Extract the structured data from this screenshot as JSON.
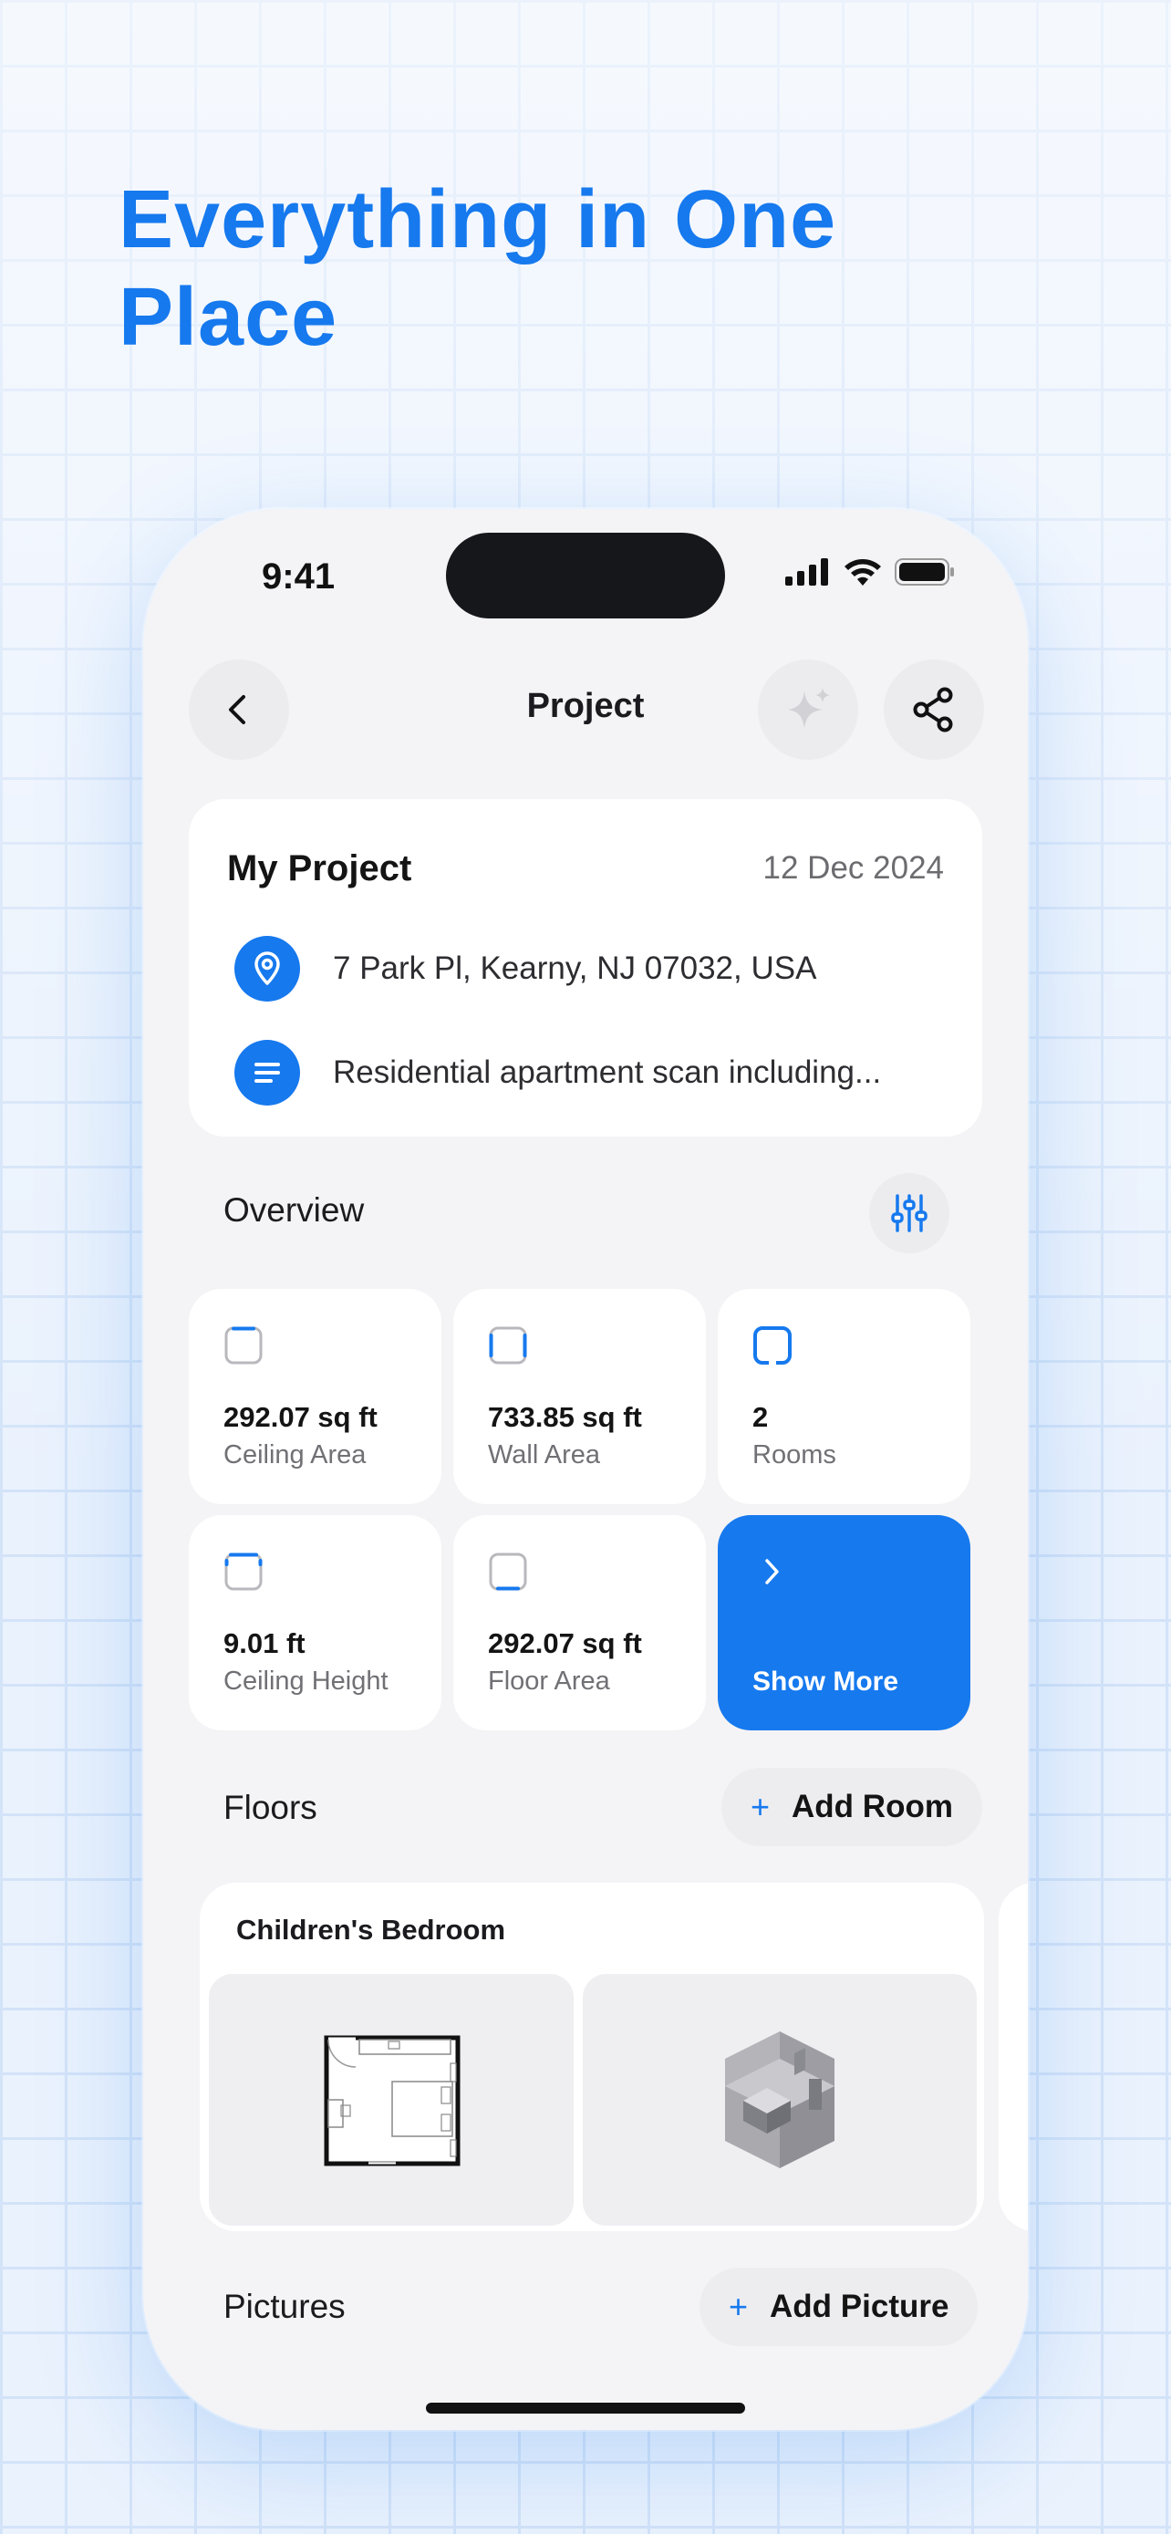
{
  "headline": "Everything in One Place",
  "status_bar": {
    "time": "9:41"
  },
  "nav": {
    "title": "Project"
  },
  "project": {
    "name": "My Project",
    "date": "12 Dec 2024",
    "address": "7 Park Pl, Kearny, NJ 07032, USA",
    "description": "Residential apartment scan including..."
  },
  "overview": {
    "title": "Overview",
    "stats": [
      {
        "value": "292.07 sq ft",
        "label": "Ceiling Area"
      },
      {
        "value": "733.85 sq ft",
        "label": "Wall Area"
      },
      {
        "value": "2",
        "label": "Rooms"
      },
      {
        "value": "9.01 ft",
        "label": "Ceiling Height"
      },
      {
        "value": "292.07 sq ft",
        "label": "Floor Area"
      }
    ],
    "show_more": "Show More"
  },
  "floors": {
    "title": "Floors",
    "add_room": "Add Room",
    "rooms": [
      {
        "name": "Children's Bedroom"
      }
    ]
  },
  "pictures": {
    "title": "Pictures",
    "add_picture": "Add Picture"
  },
  "colors": {
    "accent": "#1679ee",
    "background": "#f4f4f6",
    "card": "#ffffff"
  }
}
